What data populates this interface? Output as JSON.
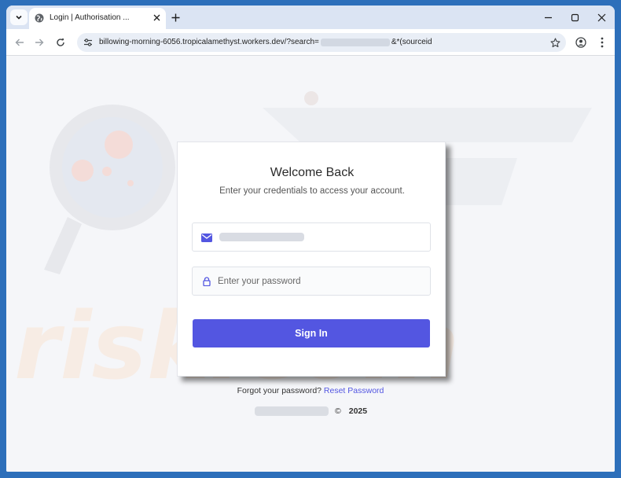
{
  "browser": {
    "tab_title": "Login | Authorisation ...",
    "url_prefix": "billowing-morning-6056.tropicalamethyst.workers.dev/?search=",
    "url_suffix": "&*(sourceid"
  },
  "login": {
    "title": "Welcome Back",
    "subtitle": "Enter your credentials to access your account.",
    "password_placeholder": "Enter your password",
    "signin_label": "Sign In",
    "forgot_text": "Forgot your password?",
    "reset_link": "Reset Password",
    "copyright_symbol": "©",
    "year": "2025"
  },
  "icons": {
    "tab_menu": "chevron-down-icon",
    "favicon": "globe-icon",
    "tab_close": "close-icon",
    "new_tab": "plus-icon",
    "minimize": "minimize-icon",
    "maximize": "maximize-icon",
    "close": "close-icon",
    "back": "back-arrow-icon",
    "forward": "forward-arrow-icon",
    "reload": "reload-icon",
    "site_info": "tune-icon",
    "bookmark": "star-icon",
    "profile": "profile-icon",
    "menu": "kebab-menu-icon",
    "email": "envelope-icon",
    "password": "lock-icon"
  },
  "colors": {
    "accent": "#5356e1",
    "desktop": "#2d6fba",
    "tabstrip": "#dbe4f3"
  }
}
